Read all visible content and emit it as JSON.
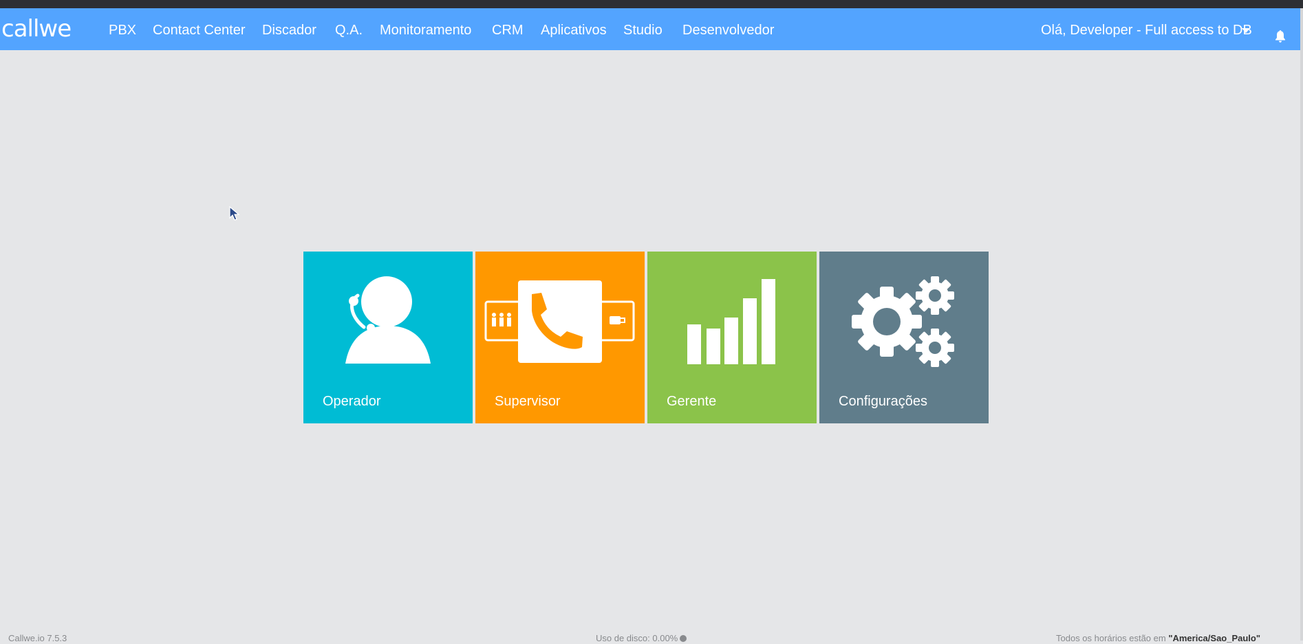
{
  "app": {
    "logo": "callwe"
  },
  "nav": {
    "items": [
      {
        "label": "PBX"
      },
      {
        "label": "Contact Center"
      },
      {
        "label": "Discador"
      },
      {
        "label": "Q.A."
      },
      {
        "label": "Monitoramento"
      },
      {
        "label": "CRM"
      },
      {
        "label": "Aplicativos"
      },
      {
        "label": "Studio"
      },
      {
        "label": "Desenvolvedor"
      }
    ],
    "user_greeting": "Olá, Developer - Full access to DB",
    "icons": {
      "dropdown": "caret-down-icon",
      "notifications": "bell-icon"
    }
  },
  "tiles": [
    {
      "label": "Operador",
      "icon": "operator-headset-icon",
      "color": "#00bcd4"
    },
    {
      "label": "Supervisor",
      "icon": "supervisor-phone-icon",
      "color": "#ff9800"
    },
    {
      "label": "Gerente",
      "icon": "bar-chart-icon",
      "color": "#8bc34a"
    },
    {
      "label": "Configurações",
      "icon": "gears-icon",
      "color": "#607d8b"
    }
  ],
  "footer": {
    "version": "Callwe.io 7.5.3",
    "disk_usage": "Uso de disco: 0.00%",
    "timezone_prefix": "Todos os horários estão em ",
    "timezone": "\"America/Sao_Paulo\""
  },
  "colors": {
    "navbar": "#53a4ff",
    "background": "#e5e6e8"
  }
}
